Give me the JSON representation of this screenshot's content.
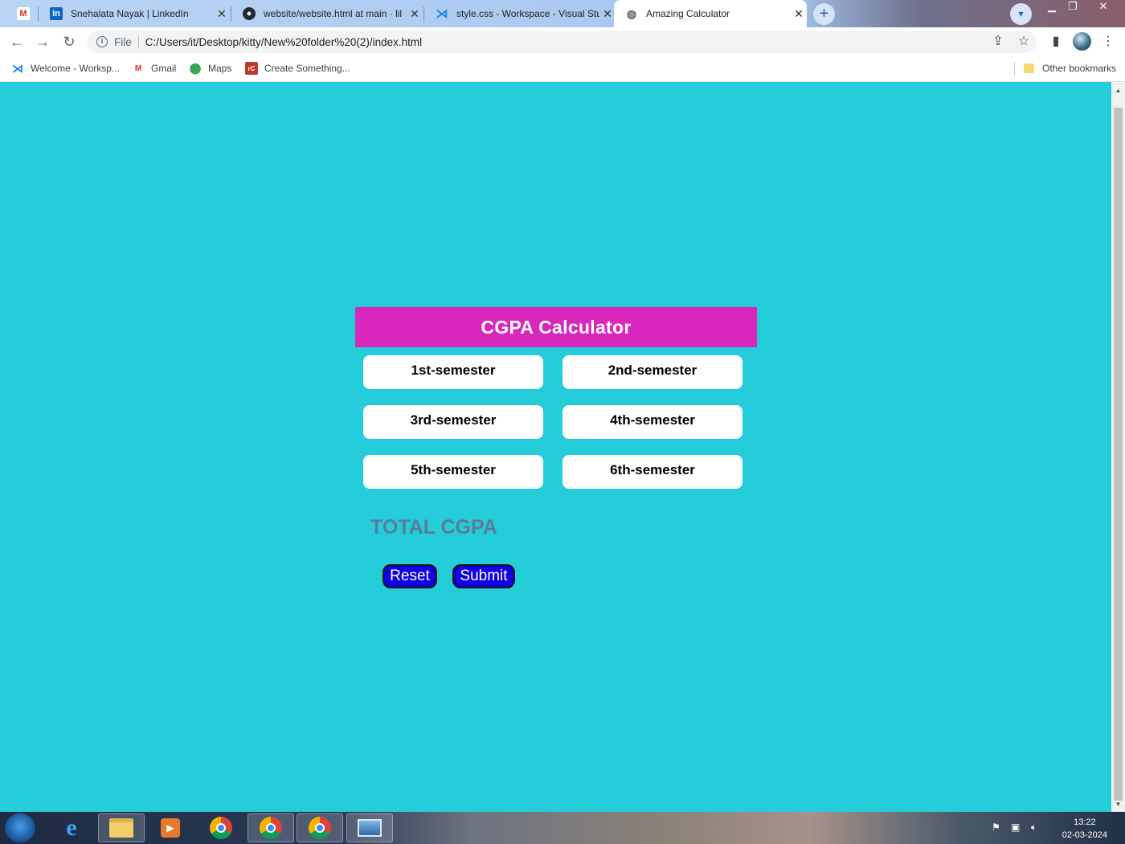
{
  "browser": {
    "tabs": [
      {
        "title": "",
        "icon": "gmail-icon"
      },
      {
        "title": "Snehalata Nayak | LinkedIn",
        "icon": "linkedin-icon"
      },
      {
        "title": "website/website.html at main · lil",
        "icon": "github-icon"
      },
      {
        "title": "style.css - Workspace - Visual Stu",
        "icon": "vscode-icon"
      },
      {
        "title": "Amazing Calculator",
        "icon": "globe-icon",
        "active": true
      }
    ],
    "close_glyph": "✕",
    "new_tab_glyph": "+",
    "url_scheme": "File",
    "url": "C:/Users/it/Desktop/kitty/New%20folder%20(2)/index.html",
    "bookmarks": [
      {
        "label": "Welcome - Worksp...",
        "icon": "vscode-icon"
      },
      {
        "label": "Gmail",
        "icon": "gmail-icon"
      },
      {
        "label": "Maps",
        "icon": "maps-icon"
      },
      {
        "label": "Create Something...",
        "icon": "create-icon"
      }
    ],
    "other_bookmarks": "Other bookmarks"
  },
  "page": {
    "header": "CGPA Calculator",
    "semesters": [
      "1st-semester",
      "2nd-semester",
      "3rd-semester",
      "4th-semester",
      "5th-semester",
      "6th-semester"
    ],
    "total_label": "TOTAL CGPA",
    "reset_label": "Reset",
    "submit_label": "Submit",
    "colors": {
      "background": "#25ccd9",
      "header": "#d927bd",
      "button": "#1000e0",
      "total_text": "#5b7c99"
    }
  },
  "taskbar": {
    "time": "13:22",
    "date": "02-03-2024"
  }
}
